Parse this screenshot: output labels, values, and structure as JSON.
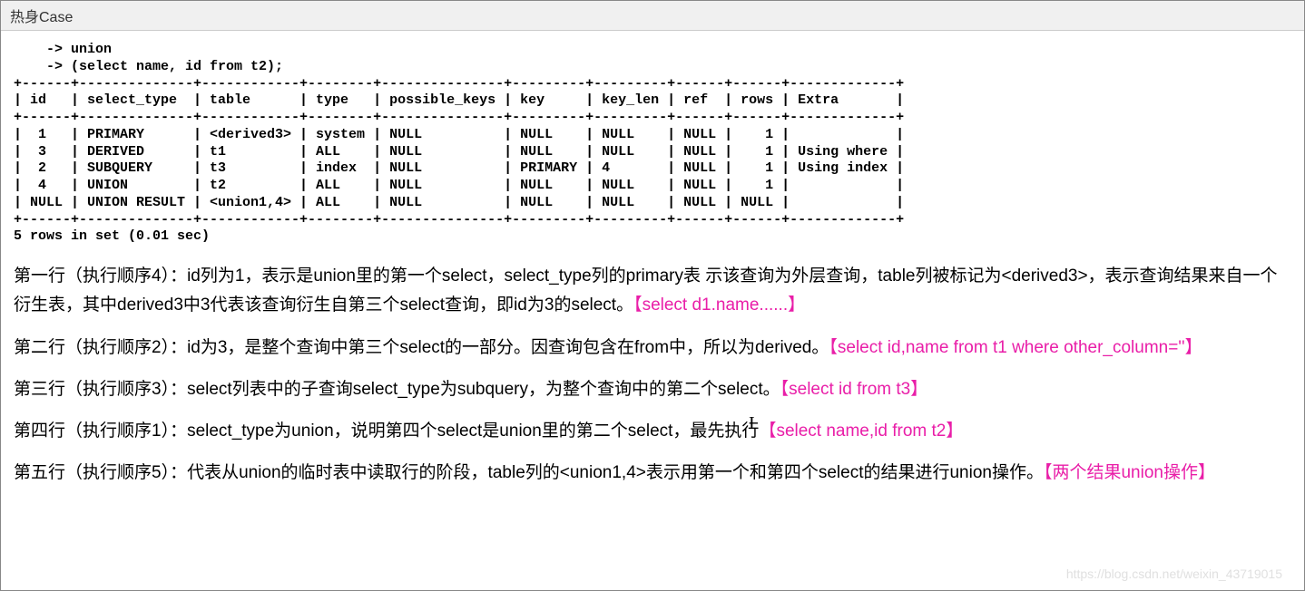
{
  "title": "热身Case",
  "code_block": "    -> union\n    -> (select name, id from t2);\n+------+--------------+------------+--------+---------------+---------+---------+------+------+-------------+\n| id   | select_type  | table      | type   | possible_keys | key     | key_len | ref  | rows | Extra       |\n+------+--------------+------------+--------+---------------+---------+---------+------+------+-------------+\n|  1   | PRIMARY      | <derived3> | system | NULL          | NULL    | NULL    | NULL |    1 |             |\n|  3   | DERIVED      | t1         | ALL    | NULL          | NULL    | NULL    | NULL |    1 | Using where |\n|  2   | SUBQUERY     | t3         | index  | NULL          | PRIMARY | 4       | NULL |    1 | Using index |\n|  4   | UNION        | t2         | ALL    | NULL          | NULL    | NULL    | NULL |    1 |             |\n| NULL | UNION RESULT | <union1,4> | ALL    | NULL          | NULL    | NULL    | NULL | NULL |             |\n+------+--------------+------------+--------+---------------+---------+---------+------+------+-------------+\n5 rows in set (0.01 sec)",
  "paragraphs": [
    {
      "text": "第一行（执行顺序4）：id列为1，表示是union里的第一个select，select_type列的primary表 示该查询为外层查询，table列被标记为<derived3>，表示查询结果来自一个衍生表，其中derived3中3代表该查询衍生自第三个select查询，即id为3的select。",
      "highlight": "【select d1.name......】"
    },
    {
      "text": "第二行（执行顺序2）：id为3，是整个查询中第三个select的一部分。因查询包含在from中，所以为derived。",
      "highlight": "【select id,name from t1 where other_column=''】"
    },
    {
      "text": "第三行（执行顺序3）：select列表中的子查询select_type为subquery，为整个查询中的第二个select。",
      "highlight": "【select id from t3】"
    },
    {
      "text": "第四行（执行顺序1）：select_type为union，说明第四个select是union里的第二个select，最先执行",
      "highlight": "【select name,id from t2】"
    },
    {
      "text": "第五行（执行顺序5）：代表从union的临时表中读取行的阶段，table列的<union1,4>表示用第一个和第四个select的结果进行union操作。",
      "highlight": "【两个结果union操作】"
    }
  ],
  "watermark": "https://blog.csdn.net/weixin_43719015"
}
